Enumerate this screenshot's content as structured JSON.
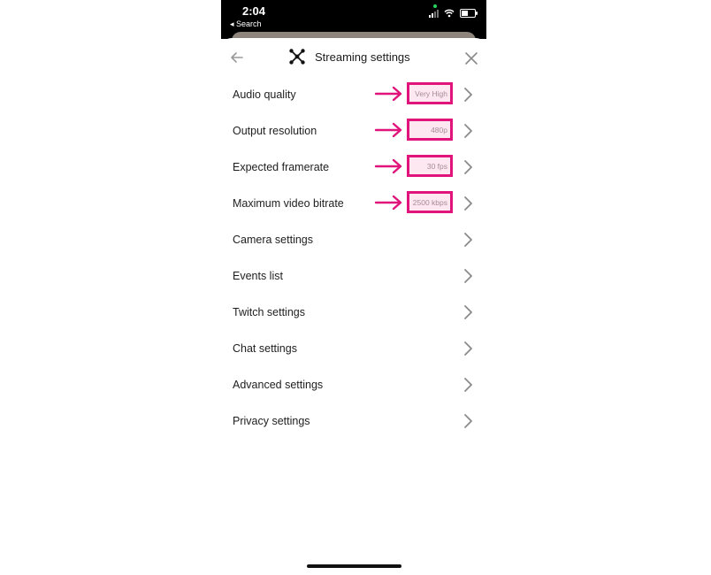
{
  "status_bar": {
    "time": "2:04",
    "back_app": "◂ Search"
  },
  "header": {
    "title": "Streaming settings",
    "icons": {
      "back": "back-arrow-icon",
      "brand": "stream-network-icon",
      "close": "close-icon"
    }
  },
  "menu": {
    "items": [
      {
        "label": "Audio quality",
        "value": "Very High"
      },
      {
        "label": "Output resolution",
        "value": "480p"
      },
      {
        "label": "Expected framerate",
        "value": "30 fps"
      },
      {
        "label": "Maximum video bitrate",
        "value": "2500 kbps"
      },
      {
        "label": "Camera settings"
      },
      {
        "label": "Events list"
      },
      {
        "label": "Twitch settings"
      },
      {
        "label": "Chat settings"
      },
      {
        "label": "Advanced settings"
      },
      {
        "label": "Privacy settings"
      }
    ]
  },
  "colors": {
    "annotation": "#e0147a",
    "annotation_fill": "#fde8f1",
    "chevron": "#8a8a8a",
    "text": "#1e1e1e"
  }
}
